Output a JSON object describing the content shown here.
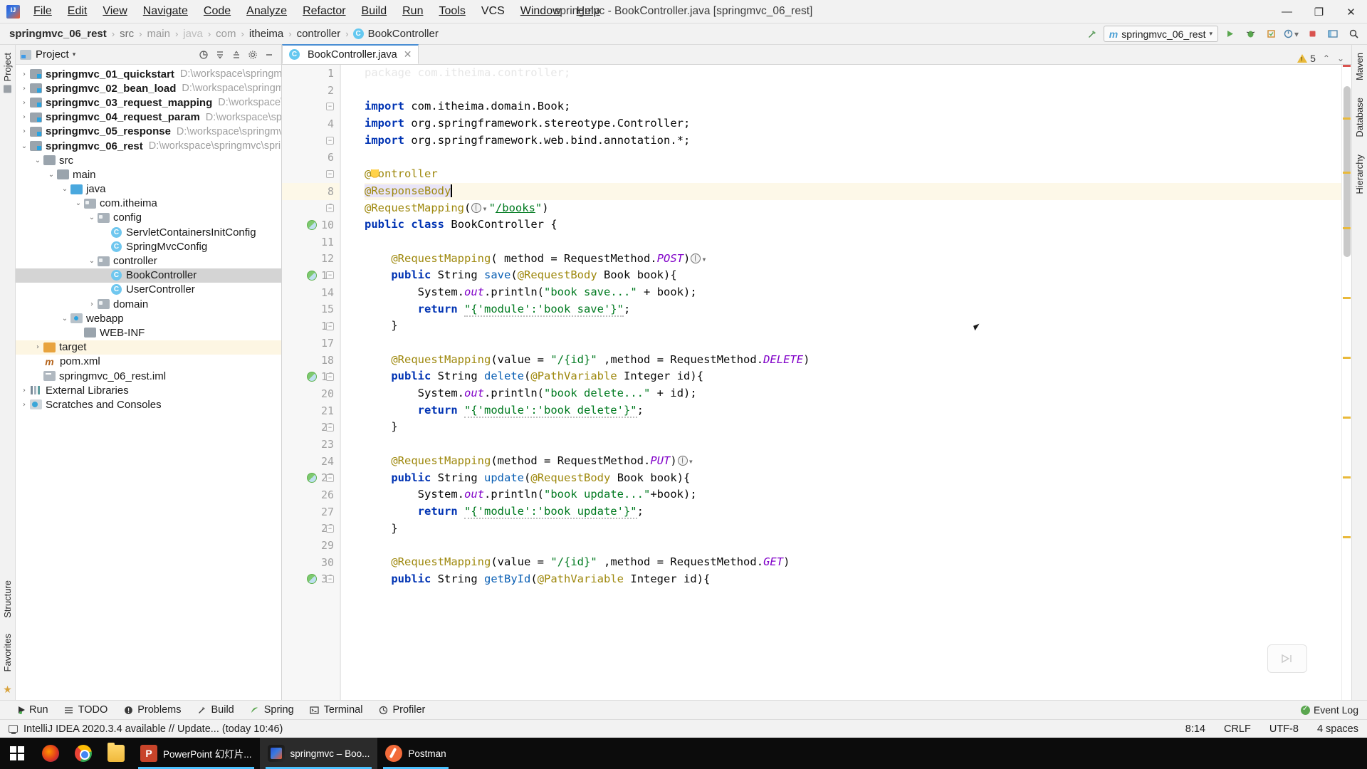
{
  "window": {
    "title": "springmvc - BookController.java [springmvc_06_rest]",
    "minimize": "—",
    "maximize": "❐",
    "close": "✕"
  },
  "menu": [
    "File",
    "Edit",
    "View",
    "Navigate",
    "Code",
    "Analyze",
    "Refactor",
    "Build",
    "Run",
    "Tools",
    "VCS",
    "Window",
    "Help"
  ],
  "breadcrumb": {
    "items": [
      "springmvc_06_rest",
      "src",
      "main",
      "java",
      "com",
      "itheima",
      "controller"
    ],
    "current_class": "BookController",
    "class_badge": "C",
    "separator": "›"
  },
  "nav_right": {
    "hammer_icon": "build-icon",
    "run_config": "springmvc_06_rest",
    "run_config_icon": "m",
    "dropdown_caret": "▾",
    "run_icon": "▶",
    "debug_icon": "🐞",
    "coverage_icon": "▤",
    "profiler_icon": "⏱",
    "stop_icon": "■",
    "layout_icon": "⬚",
    "search_icon": "🔍"
  },
  "left_rail": {
    "project_tab": "Project",
    "structure_tab": "Structure",
    "favorites_tab": "Favorites",
    "star_icon": "★"
  },
  "right_rail": {
    "maven_tab": "Maven",
    "database_tab": "Database",
    "hierarchy_tab": "Hierarchy"
  },
  "project_panel": {
    "title": "Project",
    "caret": "▾",
    "actions": [
      "target-icon",
      "collapse-all-icon",
      "expand-icon",
      "gear-icon",
      "hide-icon"
    ],
    "tree": [
      {
        "indent": 1,
        "arrow": "›",
        "icon": "module",
        "label": "springmvc_01_quickstart",
        "bold": true,
        "path": "D:\\workspace\\springmvc\\"
      },
      {
        "indent": 1,
        "arrow": "›",
        "icon": "module",
        "label": "springmvc_02_bean_load",
        "bold": true,
        "path": "D:\\workspace\\springmvc\\"
      },
      {
        "indent": 1,
        "arrow": "›",
        "icon": "module",
        "label": "springmvc_03_request_mapping",
        "bold": true,
        "path": "D:\\workspace\\spri"
      },
      {
        "indent": 1,
        "arrow": "›",
        "icon": "module",
        "label": "springmvc_04_request_param",
        "bold": true,
        "path": "D:\\workspace\\spring"
      },
      {
        "indent": 1,
        "arrow": "›",
        "icon": "module",
        "label": "springmvc_05_response",
        "bold": true,
        "path": "D:\\workspace\\springmvc\\s"
      },
      {
        "indent": 1,
        "arrow": "⌄",
        "icon": "module",
        "label": "springmvc_06_rest",
        "bold": true,
        "path": "D:\\workspace\\springmvc\\springm"
      },
      {
        "indent": 2,
        "arrow": "⌄",
        "icon": "folder",
        "label": "src",
        "bold": false,
        "path": ""
      },
      {
        "indent": 3,
        "arrow": "⌄",
        "icon": "folder",
        "label": "main",
        "bold": false,
        "path": ""
      },
      {
        "indent": 4,
        "arrow": "⌄",
        "icon": "folder-src",
        "label": "java",
        "bold": false,
        "path": ""
      },
      {
        "indent": 5,
        "arrow": "⌄",
        "icon": "package",
        "label": "com.itheima",
        "bold": false,
        "path": ""
      },
      {
        "indent": 6,
        "arrow": "⌄",
        "icon": "package",
        "label": "config",
        "bold": false,
        "path": ""
      },
      {
        "indent": 7,
        "arrow": "",
        "icon": "class",
        "label": "ServletContainersInitConfig",
        "bold": false,
        "path": ""
      },
      {
        "indent": 7,
        "arrow": "",
        "icon": "class",
        "label": "SpringMvcConfig",
        "bold": false,
        "path": ""
      },
      {
        "indent": 6,
        "arrow": "⌄",
        "icon": "package",
        "label": "controller",
        "bold": false,
        "path": ""
      },
      {
        "indent": 7,
        "arrow": "",
        "icon": "class",
        "label": "BookController",
        "bold": false,
        "path": "",
        "selected": true
      },
      {
        "indent": 7,
        "arrow": "",
        "icon": "class",
        "label": "UserController",
        "bold": false,
        "path": ""
      },
      {
        "indent": 6,
        "arrow": "›",
        "icon": "package",
        "label": "domain",
        "bold": false,
        "path": ""
      },
      {
        "indent": 4,
        "arrow": "⌄",
        "icon": "webapp",
        "label": "webapp",
        "bold": false,
        "path": ""
      },
      {
        "indent": 5,
        "arrow": "",
        "icon": "folder",
        "label": "WEB-INF",
        "bold": false,
        "path": ""
      },
      {
        "indent": 2,
        "arrow": "›",
        "icon": "folder-orange",
        "label": "target",
        "bold": false,
        "path": "",
        "highlight": true
      },
      {
        "indent": 2,
        "arrow": "",
        "icon": "xml",
        "label": "pom.xml",
        "bold": false,
        "path": ""
      },
      {
        "indent": 2,
        "arrow": "",
        "icon": "iml",
        "label": "springmvc_06_rest.iml",
        "bold": false,
        "path": ""
      },
      {
        "indent": 1,
        "arrow": "›",
        "icon": "library",
        "label": "External Libraries",
        "bold": false,
        "path": ""
      },
      {
        "indent": 1,
        "arrow": "›",
        "icon": "scratch",
        "label": "Scratches and Consoles",
        "bold": false,
        "path": ""
      }
    ]
  },
  "editor": {
    "tab": {
      "label": "BookController.java",
      "badge": "C",
      "close": "✕"
    },
    "inspection": {
      "count": "5",
      "icon": "warning-triangle",
      "up": "⌃",
      "down": "⌄"
    },
    "lines": [
      {
        "n": 1,
        "text": "package com.itheima.controller;",
        "dim": true
      },
      {
        "n": 2,
        "text": ""
      },
      {
        "n": 3,
        "text": "import com.itheima.domain.Book;"
      },
      {
        "n": 4,
        "text": "import org.springframework.stereotype.Controller;"
      },
      {
        "n": 5,
        "text": "import org.springframework.web.bind.annotation.*;"
      },
      {
        "n": 6,
        "text": ""
      },
      {
        "n": 7,
        "text": "@Controller"
      },
      {
        "n": 8,
        "text": "@ResponseBody",
        "highlight": true
      },
      {
        "n": 9,
        "text": "@RequestMapping(\"/books\")"
      },
      {
        "n": 10,
        "text": "public class BookController {",
        "runmarker": true
      },
      {
        "n": 11,
        "text": ""
      },
      {
        "n": 12,
        "text": "    @RequestMapping( method = RequestMethod.POST)"
      },
      {
        "n": 13,
        "text": "    public String save(@RequestBody Book book){",
        "runmarker": true
      },
      {
        "n": 14,
        "text": "        System.out.println(\"book save...\" + book);"
      },
      {
        "n": 15,
        "text": "        return \"{'module':'book save'}\";"
      },
      {
        "n": 16,
        "text": "    }"
      },
      {
        "n": 17,
        "text": ""
      },
      {
        "n": 18,
        "text": "    @RequestMapping(value = \"/{id}\" ,method = RequestMethod.DELETE)"
      },
      {
        "n": 19,
        "text": "    public String delete(@PathVariable Integer id){",
        "runmarker": true
      },
      {
        "n": 20,
        "text": "        System.out.println(\"book delete...\" + id);"
      },
      {
        "n": 21,
        "text": "        return \"{'module':'book delete'}\";"
      },
      {
        "n": 22,
        "text": "    }"
      },
      {
        "n": 23,
        "text": ""
      },
      {
        "n": 24,
        "text": "    @RequestMapping(method = RequestMethod.PUT)"
      },
      {
        "n": 25,
        "text": "    public String update(@RequestBody Book book){",
        "runmarker": true
      },
      {
        "n": 26,
        "text": "        System.out.println(\"book update...\"+book);"
      },
      {
        "n": 27,
        "text": "        return \"{'module':'book update'}\";"
      },
      {
        "n": 28,
        "text": "    }"
      },
      {
        "n": 29,
        "text": ""
      },
      {
        "n": 30,
        "text": "    @RequestMapping(value = \"/{id}\" ,method = RequestMethod.GET)"
      },
      {
        "n": 31,
        "text": "    public String getById(@PathVariable Integer id){",
        "runmarker": true
      }
    ]
  },
  "toolstrip": {
    "items": [
      {
        "label": "Run",
        "icon": "run-icon"
      },
      {
        "label": "TODO",
        "icon": "todo-icon"
      },
      {
        "label": "Problems",
        "icon": "problems-icon"
      },
      {
        "label": "Build",
        "icon": "build-icon"
      },
      {
        "label": "Spring",
        "icon": "spring-icon"
      },
      {
        "label": "Terminal",
        "icon": "terminal-icon"
      },
      {
        "label": "Profiler",
        "icon": "profiler-icon"
      }
    ],
    "event_log": "Event Log"
  },
  "statusbar": {
    "message": "IntelliJ IDEA 2020.3.4 available // Update... (today 10:46)",
    "caret_position": "8:14",
    "line_separator": "CRLF",
    "encoding": "UTF-8",
    "indent": "4 spaces"
  },
  "taskbar": {
    "start": "windows-logo",
    "apps": [
      {
        "name": "firefox",
        "label": "",
        "icon": "ic-firefox",
        "state": ""
      },
      {
        "name": "chrome",
        "label": "",
        "icon": "ic-chrome",
        "state": ""
      },
      {
        "name": "file-explorer",
        "label": "",
        "icon": "ic-explorer",
        "state": ""
      },
      {
        "name": "powerpoint",
        "label": "PowerPoint 幻灯片...",
        "icon": "ic-ppt",
        "state": "open"
      },
      {
        "name": "intellij-idea",
        "label": "springmvc – Boo...",
        "icon": "ic-ij",
        "state": "active"
      },
      {
        "name": "postman",
        "label": "Postman",
        "icon": "ic-postman",
        "state": "open"
      }
    ]
  },
  "colors": {
    "keyword": "#0033b3",
    "annotation": "#9e880d",
    "string": "#007a20",
    "static_field": "#8000c8",
    "method": "#0a5fb4",
    "accent": "#4a8fd4",
    "warning": "#e9b93a",
    "selection": "#d4d4d4"
  }
}
